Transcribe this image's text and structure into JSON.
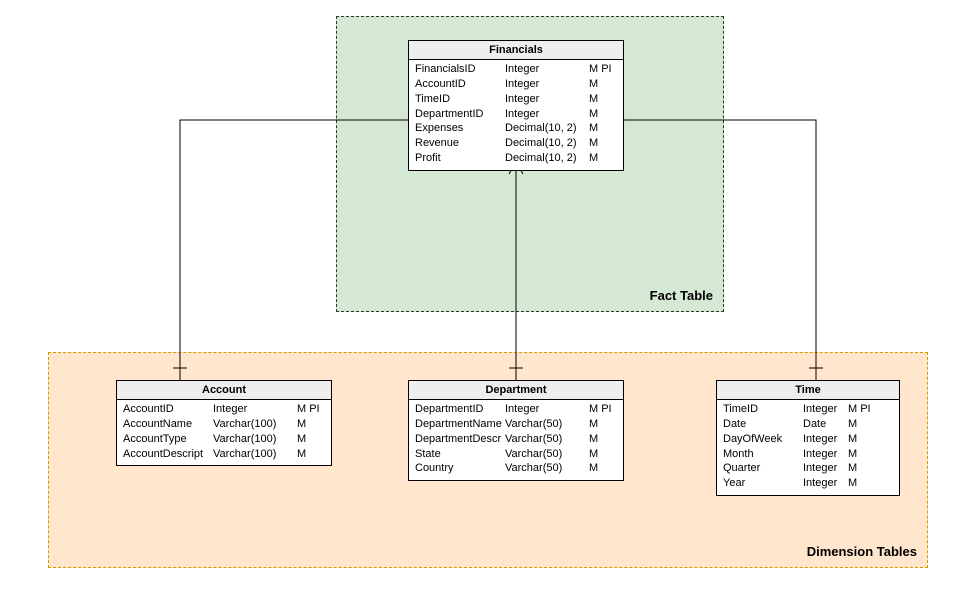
{
  "zones": {
    "fact": {
      "label": "Fact Table"
    },
    "dim": {
      "label": "Dimension Tables"
    }
  },
  "entities": {
    "financials": {
      "title": "Financials",
      "rows": [
        {
          "name": "FinancialsID",
          "type": "Integer",
          "flags": "M PI"
        },
        {
          "name": "AccountID",
          "type": "Integer",
          "flags": "M"
        },
        {
          "name": "TimeID",
          "type": "Integer",
          "flags": "M"
        },
        {
          "name": "DepartmentID",
          "type": "Integer",
          "flags": "M"
        },
        {
          "name": "Expenses",
          "type": "Decimal(10, 2)",
          "flags": "M"
        },
        {
          "name": "Revenue",
          "type": "Decimal(10, 2)",
          "flags": "M"
        },
        {
          "name": "Profit",
          "type": "Decimal(10, 2)",
          "flags": "M"
        }
      ]
    },
    "account": {
      "title": "Account",
      "rows": [
        {
          "name": "AccountID",
          "type": "Integer",
          "flags": "M PI"
        },
        {
          "name": "AccountName",
          "type": "Varchar(100)",
          "flags": "M"
        },
        {
          "name": "AccountType",
          "type": "Varchar(100)",
          "flags": "M"
        },
        {
          "name": "AccountDescript",
          "type": "Varchar(100)",
          "flags": "M"
        }
      ]
    },
    "department": {
      "title": "Department",
      "rows": [
        {
          "name": "DepartmentID",
          "type": "Integer",
          "flags": "M PI"
        },
        {
          "name": "DepartmentName",
          "type": "Varchar(50)",
          "flags": "M"
        },
        {
          "name": "DepartmentDescr",
          "type": "Varchar(50)",
          "flags": "M"
        },
        {
          "name": "State",
          "type": "Varchar(50)",
          "flags": "M"
        },
        {
          "name": "Country",
          "type": "Varchar(50)",
          "flags": "M"
        }
      ]
    },
    "time": {
      "title": "Time",
      "rows": [
        {
          "name": "TimeID",
          "type": "Integer",
          "flags": "M PI"
        },
        {
          "name": "Date",
          "type": "Date",
          "flags": "M"
        },
        {
          "name": "DayOfWeek",
          "type": "Integer",
          "flags": "M"
        },
        {
          "name": "Month",
          "type": "Integer",
          "flags": "M"
        },
        {
          "name": "Quarter",
          "type": "Integer",
          "flags": "M"
        },
        {
          "name": "Year",
          "type": "Integer",
          "flags": "M"
        }
      ]
    }
  }
}
